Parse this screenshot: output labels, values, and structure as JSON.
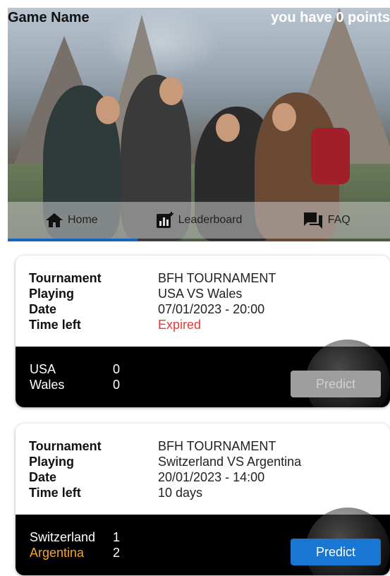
{
  "header": {
    "title": "Game Name",
    "points_text": "you have 0 points"
  },
  "nav": {
    "tabs": [
      {
        "label": "Home",
        "icon": "home-icon",
        "active": true
      },
      {
        "label": "Leaderboard",
        "icon": "leaderboard-icon",
        "active": false
      },
      {
        "label": "FAQ",
        "icon": "chat-icon",
        "active": false
      }
    ]
  },
  "labels": {
    "tournament": "Tournament",
    "playing": "Playing",
    "date": "Date",
    "time_left": "Time left",
    "predict": "Predict"
  },
  "matches": [
    {
      "tournament": "BFH TOURNAMENT",
      "playing": "USA VS Wales",
      "date": "07/01/2023 - 20:00",
      "time_left": "Expired",
      "home_team": "USA",
      "home_score": "0",
      "away_team": "Wales",
      "away_score": "0",
      "predict_enabled": false
    },
    {
      "tournament": "BFH TOURNAMENT",
      "playing": "Switzerland VS Argentina",
      "date": "20/01/2023 - 14:00",
      "time_left": "10 days",
      "home_team": "Switzerland",
      "home_score": "1",
      "away_team": "Argentina",
      "away_score": "2",
      "predict_enabled": true
    }
  ],
  "colors": {
    "accent": "#1976d2",
    "expired": "#e53935",
    "highlight_team": "#f5a623"
  }
}
